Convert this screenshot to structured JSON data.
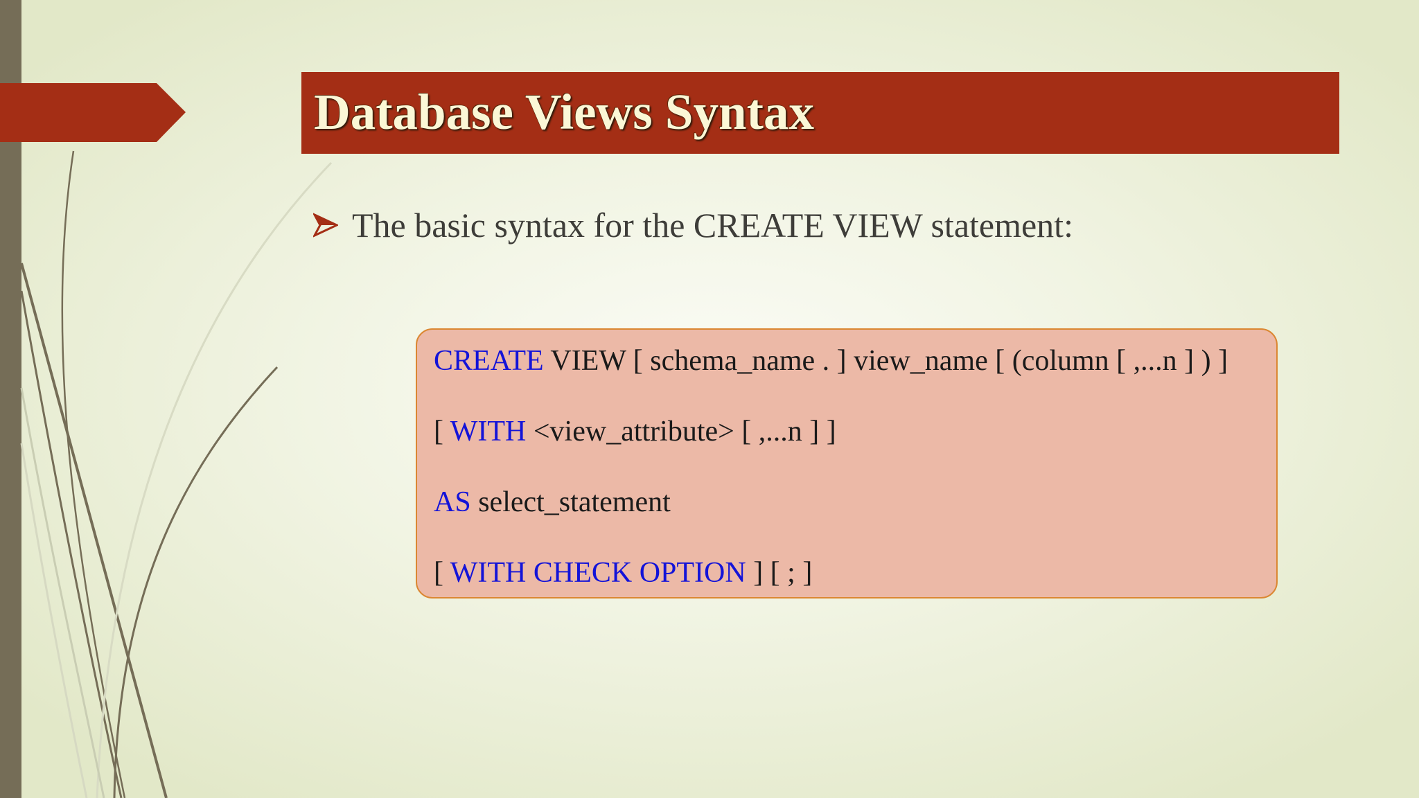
{
  "slide": {
    "title": "Database Views Syntax",
    "bullet": {
      "icon": "arrow-bullet-icon",
      "text": "The basic syntax for the CREATE VIEW statement:"
    },
    "code": {
      "line1": {
        "keyword": "CREATE",
        "rest": " VIEW [ schema_name . ] view_name [ (column [ ,...n ] ) ]"
      },
      "line2": {
        "pre": "[ ",
        "keyword": "WITH",
        "rest": " <view_attribute> [ ,...n ] ]"
      },
      "line3": {
        "keyword": "AS",
        "rest": " select_statement"
      },
      "line4": {
        "pre": "[ ",
        "keyword": "WITH CHECK OPTION",
        "rest": " ] [ ; ]"
      }
    }
  },
  "colors": {
    "title_banner": "#a42e15",
    "title_text": "#fbf7d6",
    "left_bar": "#756d57",
    "code_box_fill": "#ecb9a7",
    "code_box_border": "#db8732",
    "keyword": "#1313d8",
    "bullet_arrow": "#a42e15"
  }
}
